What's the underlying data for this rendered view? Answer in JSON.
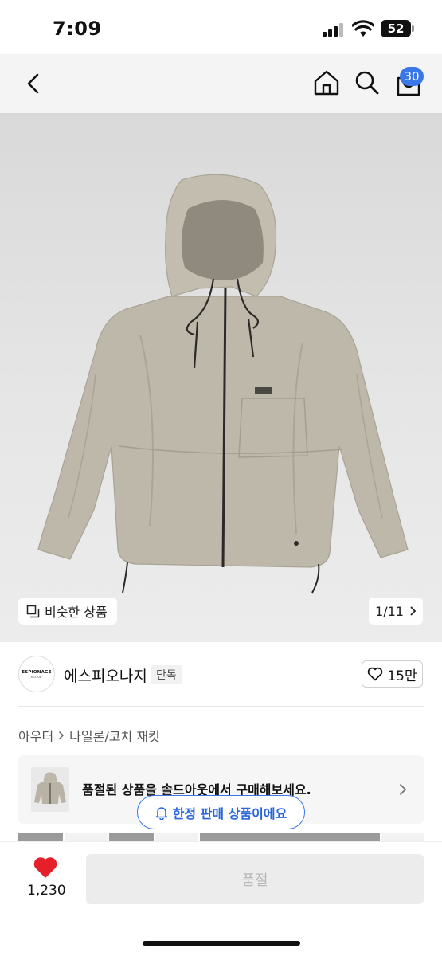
{
  "status_bar": {
    "time": "7:09",
    "battery": "52"
  },
  "nav": {
    "cart_count": "30"
  },
  "gallery": {
    "similar_label": "비슷한 상품",
    "pager": "1/11"
  },
  "brand": {
    "logo_text": "ESPIONAGE",
    "logo_subtext": "EST.'06'",
    "name": "에스피오나지",
    "badge": "단독",
    "likes": "15만"
  },
  "breadcrumb": {
    "items": [
      "아우터",
      "나일론/코치 재킷"
    ]
  },
  "soldout_banner": {
    "text": "품절된 상품을 솔드아웃에서 구매해보세요."
  },
  "limited_notice": {
    "text": "한정 판매 상품이에요"
  },
  "bottom_bar": {
    "wish_count": "1,230",
    "cta_label": "품절"
  },
  "colors": {
    "accent": "#3b78e7",
    "heart": "#e5202a",
    "jacket": "#b9b5a6"
  }
}
